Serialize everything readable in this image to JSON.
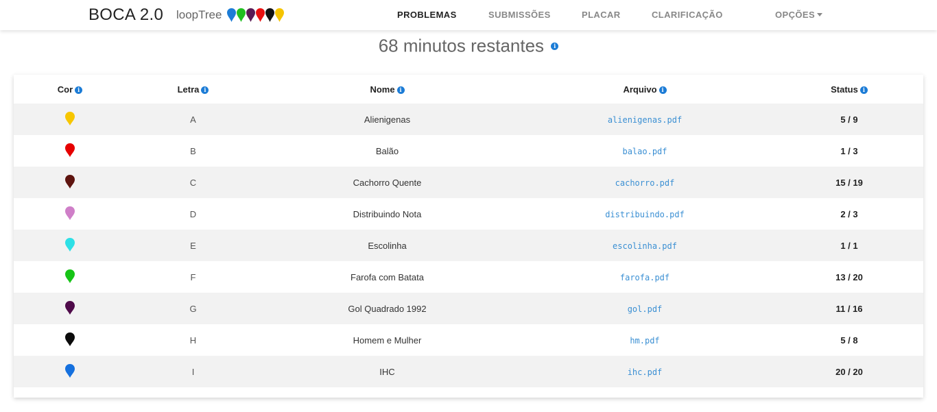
{
  "navbar": {
    "brand": "BOCA 2.0",
    "team": "loopTree",
    "balloons": [
      "#1c7cd6",
      "#20c020",
      "#5a1a55",
      "#e81010",
      "#111111",
      "#f5c400"
    ],
    "links": {
      "problems": "PROBLEMAS",
      "submissions": "SUBMISSÕES",
      "scoreboard": "PLACAR",
      "clarification": "CLARIFICAÇÃO",
      "options": "OPÇÕES"
    }
  },
  "remaining": {
    "text": "68 minutos restantes"
  },
  "table": {
    "headers": {
      "color": "Cor",
      "letter": "Letra",
      "name": "Nome",
      "file": "Arquivo",
      "status": "Status"
    },
    "rows": [
      {
        "color": "#f7c600",
        "letter": "A",
        "name": "Alienigenas",
        "file": "alienigenas.pdf",
        "status": "5 / 9"
      },
      {
        "color": "#e60000",
        "letter": "B",
        "name": "Balão",
        "file": "balao.pdf",
        "status": "1 / 3"
      },
      {
        "color": "#5e140f",
        "letter": "C",
        "name": "Cachorro Quente",
        "file": "cachorro.pdf",
        "status": "15 / 19"
      },
      {
        "color": "#cf7fc8",
        "letter": "D",
        "name": "Distribuindo Nota",
        "file": "distribuindo.pdf",
        "status": "2 / 3"
      },
      {
        "color": "#2ee0e6",
        "letter": "E",
        "name": "Escolinha",
        "file": "escolinha.pdf",
        "status": "1 / 1"
      },
      {
        "color": "#16c416",
        "letter": "F",
        "name": "Farofa com Batata",
        "file": "farofa.pdf",
        "status": "13 / 20"
      },
      {
        "color": "#4f0b4a",
        "letter": "G",
        "name": "Gol Quadrado 1992",
        "file": "gol.pdf",
        "status": "11 / 16"
      },
      {
        "color": "#0b0b0b",
        "letter": "H",
        "name": "Homem e Mulher",
        "file": "hm.pdf",
        "status": "5 / 8"
      },
      {
        "color": "#1570de",
        "letter": "I",
        "name": "IHC",
        "file": "ihc.pdf",
        "status": "20 / 20"
      }
    ]
  },
  "icons": {
    "info": "info-circle-icon",
    "balloon": "map-marker-icon",
    "caret": "caret-down-icon"
  }
}
